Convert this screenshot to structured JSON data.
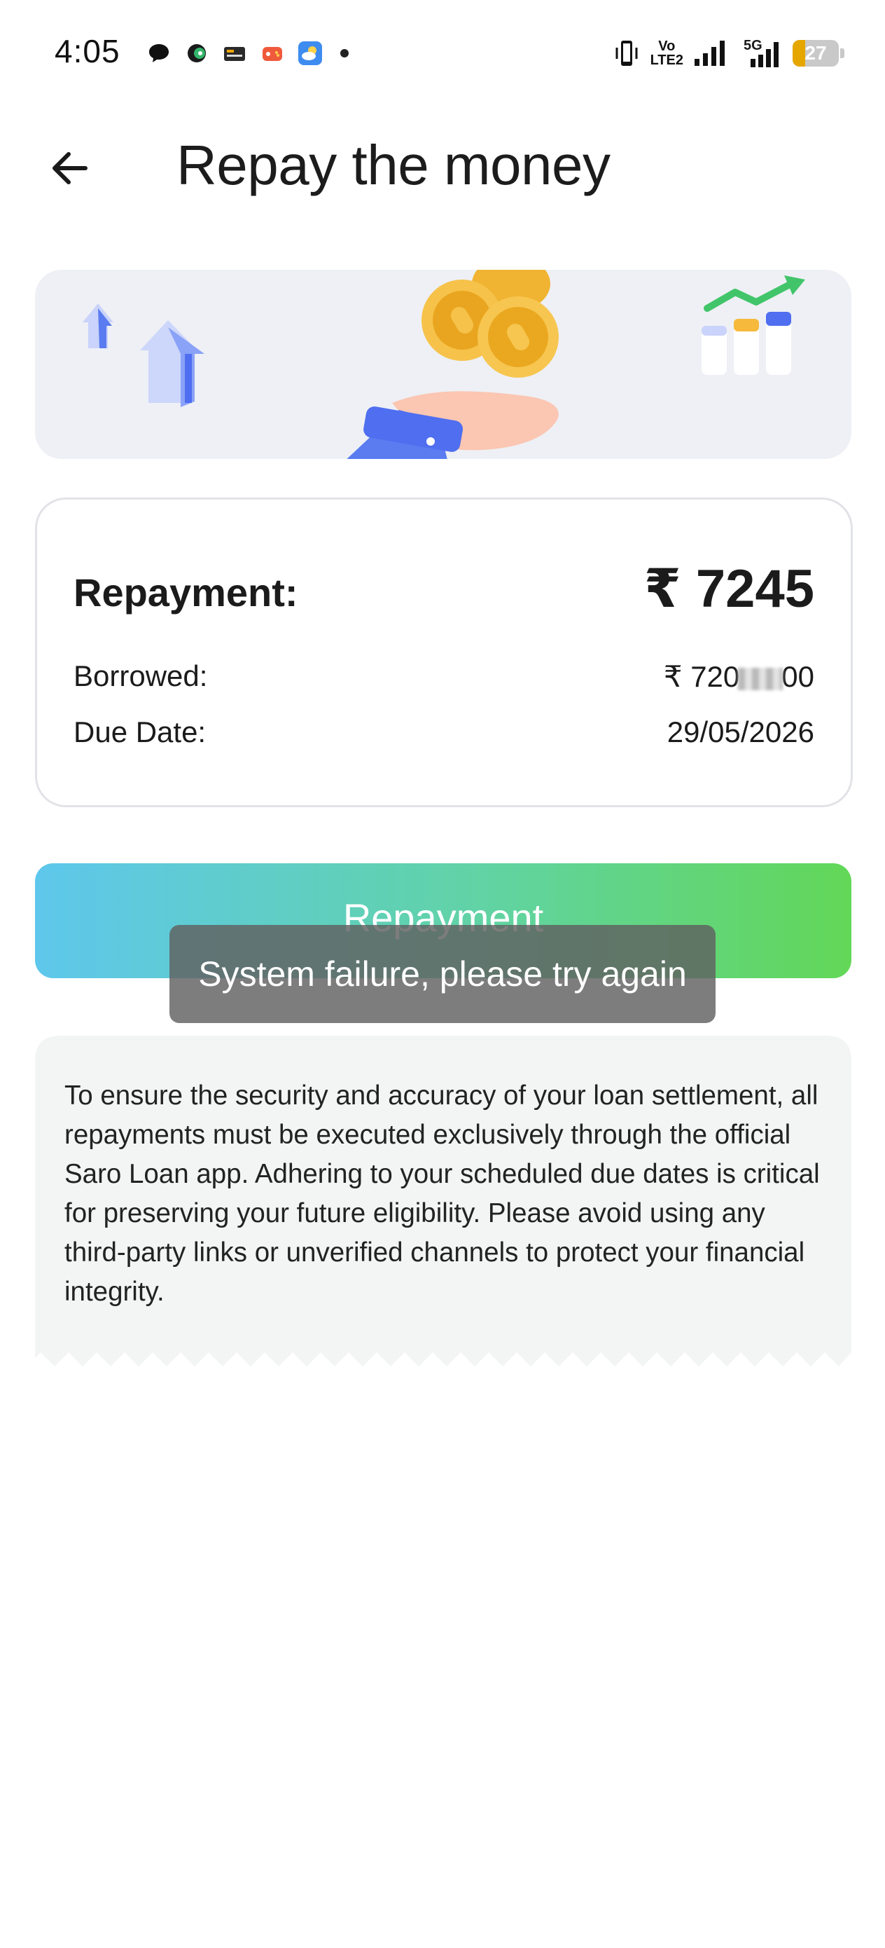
{
  "status_bar": {
    "time": "4:05",
    "volte_line1": "Vo",
    "volte_line2": "LTE2",
    "network": "5G",
    "battery": "27",
    "battery_color": "#e6a600"
  },
  "header": {
    "title": "Repay the money",
    "back_icon": "arrow-left-icon"
  },
  "summary": {
    "repayment_label": "Repayment:",
    "repayment_value": "₹ 7245",
    "borrowed_label": "Borrowed:",
    "borrowed_prefix": "₹ 720",
    "borrowed_suffix": "00",
    "due_date_label": "Due Date:",
    "due_date_value": "29/05/2026"
  },
  "actions": {
    "repay_button": "Repayment",
    "gradient_start": "#5ec7ec",
    "gradient_end": "#62d757"
  },
  "toast": {
    "message": "System failure, please try again"
  },
  "notice": {
    "text": "To ensure the security and accuracy of your loan settlement, all repayments must be executed exclusively through the official Saro Loan app. Adhering to your scheduled due dates is critical for preserving your future eligibility. Please avoid using any third-party links or unverified channels to protect your financial integrity."
  }
}
